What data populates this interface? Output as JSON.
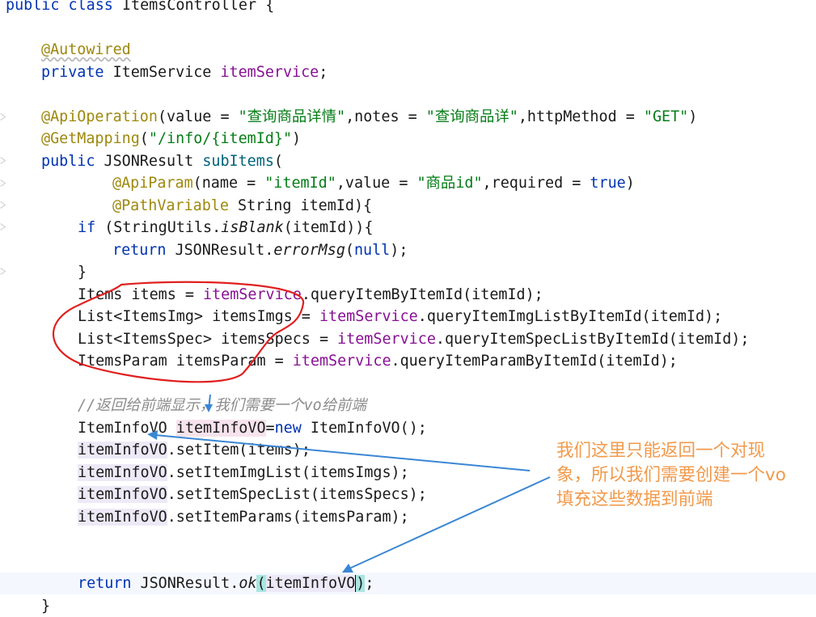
{
  "code": {
    "l1": {
      "kw": "public class",
      "rest": " ItemsController {"
    },
    "l2": {
      "ann": "@Autowired"
    },
    "l3": {
      "kw": "private",
      "type": " ItemService ",
      "fld": "itemService",
      "end": ";"
    },
    "l4": {
      "ann": "@ApiOperation",
      "a": "(value = ",
      "s1": "\"查询商品详情\"",
      "b": ",notes = ",
      "s2": "\"查询商品详\"",
      "c": ",httpMethod = ",
      "s3": "\"GET\"",
      "d": ")"
    },
    "l5": {
      "ann": "@GetMapping",
      "a": "(",
      "s1": "\"/info/{itemId}\"",
      "b": ")"
    },
    "l6": {
      "kw": "public",
      "type": " JSONResult ",
      "name": "subItems",
      "end": "("
    },
    "l7": {
      "ann": "@ApiParam",
      "a": "(name = ",
      "s1": "\"itemId\"",
      "b": ",value = ",
      "s2": "\"商品id\"",
      "c": ",required = ",
      "kw": "true",
      "d": ")"
    },
    "l8": {
      "ann": "@PathVariable",
      "rest": " String itemId){"
    },
    "l9": {
      "kw": "if",
      "a": " (StringUtils.",
      "it": "isBlank",
      "b": "(itemId)){"
    },
    "l10": {
      "kw": "return",
      "a": " JSONResult.",
      "it": "errorMsg",
      "b": "(",
      "kw2": "null",
      "c": ");"
    },
    "l11": {
      "a": "}"
    },
    "l12": {
      "a": "Items items = ",
      "fld": "itemService",
      "b": ".queryItemByItemId(itemId);"
    },
    "l13": {
      "a": "List<ItemsImg> itemsImgs = ",
      "fld": "itemService",
      "b": ".queryItemImgListByItemId(itemId);"
    },
    "l14": {
      "a": "List<ItemsSpec> itemsSpecs = ",
      "fld": "itemService",
      "b": ".queryItemSpecListByItemId(itemId);"
    },
    "l15": {
      "a": "ItemsParam itemsParam = ",
      "fld": "itemService",
      "b": ".queryItemParamByItemId(itemId);"
    },
    "l16": {
      "cmt": "//返回给前端显示，我们需要一个vo给前端"
    },
    "l17": {
      "a": "ItemInfoVO ",
      "var": "itemInfoVO",
      "b": "=",
      "kw": "new",
      "c": " ItemInfoVO();"
    },
    "l18": {
      "var": "itemInfoVO",
      "a": ".setItem(items);"
    },
    "l19": {
      "var": "itemInfoVO",
      "a": ".setItemImgList(itemsImgs);"
    },
    "l20": {
      "var": "itemInfoVO",
      "a": ".setItemSpecList(itemsSpecs);"
    },
    "l21": {
      "var": "itemInfoVO",
      "a": ".setItemParams(itemsParam);"
    },
    "l22": {
      "kw": "return",
      "a": " JSONResult.",
      "it": "ok",
      "p1": "(",
      "var": "itemInfoVO",
      "p2": ")",
      "b": ";"
    },
    "l23": {
      "a": "}"
    }
  },
  "note": {
    "line1": "我们这里只能返回一个对现",
    "line2": "象，所以我们需要创建一个vo",
    "line3": "填充这些数据到前端"
  },
  "colors": {
    "keyword": "#0033b3",
    "annotation": "#9e880d",
    "string": "#067d17",
    "field": "#871094",
    "comment": "#8c8c8c",
    "note_text": "#f2994a",
    "red_circle": "#e02020",
    "arrow_blue": "#3a86d4"
  }
}
